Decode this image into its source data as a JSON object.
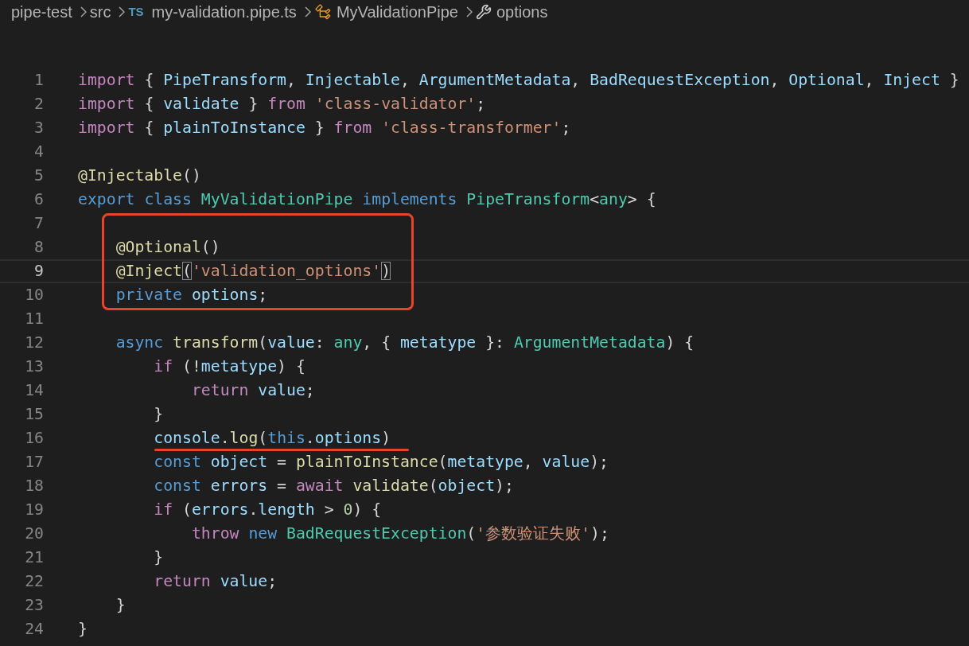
{
  "breadcrumb": [
    {
      "label": "pipe-test"
    },
    {
      "label": "src"
    },
    {
      "label": "my-validation.pipe.ts",
      "badge": "TS"
    },
    {
      "label": "MyValidationPipe",
      "kind": "class"
    },
    {
      "label": "options",
      "kind": "property"
    }
  ],
  "lines": [
    {
      "number": "1",
      "tokens": [
        {
          "kind": "control",
          "text": "import"
        },
        {
          "kind": "plain",
          "text": " { "
        },
        {
          "kind": "variable",
          "text": "PipeTransform"
        },
        {
          "kind": "plain",
          "text": ", "
        },
        {
          "kind": "variable",
          "text": "Injectable"
        },
        {
          "kind": "plain",
          "text": ", "
        },
        {
          "kind": "variable",
          "text": "ArgumentMetadata"
        },
        {
          "kind": "plain",
          "text": ", "
        },
        {
          "kind": "variable",
          "text": "BadRequestException"
        },
        {
          "kind": "plain",
          "text": ", "
        },
        {
          "kind": "variable",
          "text": "Optional"
        },
        {
          "kind": "plain",
          "text": ", "
        },
        {
          "kind": "variable",
          "text": "Inject"
        },
        {
          "kind": "plain",
          "text": " }"
        }
      ]
    },
    {
      "number": "2",
      "tokens": [
        {
          "kind": "control",
          "text": "import"
        },
        {
          "kind": "plain",
          "text": " { "
        },
        {
          "kind": "variable",
          "text": "validate"
        },
        {
          "kind": "plain",
          "text": " } "
        },
        {
          "kind": "control",
          "text": "from"
        },
        {
          "kind": "string",
          "text": " 'class-validator'"
        },
        {
          "kind": "plain",
          "text": ";"
        }
      ]
    },
    {
      "number": "3",
      "tokens": [
        {
          "kind": "control",
          "text": "import"
        },
        {
          "kind": "plain",
          "text": " { "
        },
        {
          "kind": "variable",
          "text": "plainToInstance"
        },
        {
          "kind": "plain",
          "text": " } "
        },
        {
          "kind": "control",
          "text": "from"
        },
        {
          "kind": "string",
          "text": " 'class-transformer'"
        },
        {
          "kind": "plain",
          "text": ";"
        }
      ]
    },
    {
      "number": "4"
    },
    {
      "number": "5",
      "tokens": [
        {
          "kind": "function",
          "text": "@Injectable"
        },
        {
          "kind": "plain",
          "text": "()"
        }
      ]
    },
    {
      "number": "6",
      "tokens": [
        {
          "kind": "keyword",
          "text": "export"
        },
        {
          "kind": "keyword",
          "text": " class"
        },
        {
          "kind": "type",
          "text": " MyValidationPipe"
        },
        {
          "kind": "keyword",
          "text": " implements"
        },
        {
          "kind": "type",
          "text": " PipeTransform"
        },
        {
          "kind": "plain",
          "text": "<"
        },
        {
          "kind": "type",
          "text": "any"
        },
        {
          "kind": "plain",
          "text": "> {"
        }
      ]
    },
    {
      "number": "7",
      "boxed": true
    },
    {
      "number": "8",
      "boxed": true,
      "tokens": [
        {
          "kind": "function",
          "text": "    @Optional"
        },
        {
          "kind": "plain",
          "text": "()"
        }
      ]
    },
    {
      "number": "9",
      "boxed": true,
      "current": true,
      "tokens": [
        {
          "kind": "function",
          "text": "    @Inject"
        },
        {
          "kind": "bracket",
          "text": "("
        },
        {
          "kind": "string",
          "text": "'validation_options'"
        },
        {
          "kind": "bracket",
          "text": ")"
        }
      ]
    },
    {
      "number": "10",
      "boxed": true,
      "tokens": [
        {
          "kind": "keyword",
          "text": "    private"
        },
        {
          "kind": "variable",
          "text": " options"
        },
        {
          "kind": "plain",
          "text": ";"
        }
      ]
    },
    {
      "number": "11"
    },
    {
      "number": "12",
      "tokens": [
        {
          "kind": "keyword",
          "text": "    async"
        },
        {
          "kind": "function",
          "text": " transform"
        },
        {
          "kind": "plain",
          "text": "("
        },
        {
          "kind": "variable",
          "text": "value"
        },
        {
          "kind": "plain",
          "text": ": "
        },
        {
          "kind": "type",
          "text": "any"
        },
        {
          "kind": "plain",
          "text": ", { "
        },
        {
          "kind": "variable",
          "text": "metatype"
        },
        {
          "kind": "plain",
          "text": " }: "
        },
        {
          "kind": "type",
          "text": "ArgumentMetadata"
        },
        {
          "kind": "plain",
          "text": ") {"
        }
      ]
    },
    {
      "number": "13",
      "tokens": [
        {
          "kind": "control",
          "text": "        if"
        },
        {
          "kind": "plain",
          "text": " (!"
        },
        {
          "kind": "variable",
          "text": "metatype"
        },
        {
          "kind": "plain",
          "text": ") {"
        }
      ]
    },
    {
      "number": "14",
      "tokens": [
        {
          "kind": "control",
          "text": "            return"
        },
        {
          "kind": "variable",
          "text": " value"
        },
        {
          "kind": "plain",
          "text": ";"
        }
      ]
    },
    {
      "number": "15",
      "tokens": [
        {
          "kind": "plain",
          "text": "        }"
        }
      ]
    },
    {
      "number": "16",
      "underlined": true,
      "tokens": [
        {
          "kind": "variable",
          "text": "        console"
        },
        {
          "kind": "plain",
          "text": "."
        },
        {
          "kind": "function",
          "text": "log"
        },
        {
          "kind": "plain",
          "text": "("
        },
        {
          "kind": "keyword",
          "text": "this"
        },
        {
          "kind": "plain",
          "text": "."
        },
        {
          "kind": "variable",
          "text": "options"
        },
        {
          "kind": "plain",
          "text": ")"
        }
      ]
    },
    {
      "number": "17",
      "tokens": [
        {
          "kind": "keyword",
          "text": "        const"
        },
        {
          "kind": "variable",
          "text": " object"
        },
        {
          "kind": "plain",
          "text": " = "
        },
        {
          "kind": "function",
          "text": "plainToInstance"
        },
        {
          "kind": "plain",
          "text": "("
        },
        {
          "kind": "variable",
          "text": "metatype"
        },
        {
          "kind": "plain",
          "text": ", "
        },
        {
          "kind": "variable",
          "text": "value"
        },
        {
          "kind": "plain",
          "text": ");"
        }
      ]
    },
    {
      "number": "18",
      "tokens": [
        {
          "kind": "keyword",
          "text": "        const"
        },
        {
          "kind": "variable",
          "text": " errors"
        },
        {
          "kind": "plain",
          "text": " = "
        },
        {
          "kind": "control",
          "text": "await"
        },
        {
          "kind": "function",
          "text": " validate"
        },
        {
          "kind": "plain",
          "text": "("
        },
        {
          "kind": "variable",
          "text": "object"
        },
        {
          "kind": "plain",
          "text": ");"
        }
      ]
    },
    {
      "number": "19",
      "tokens": [
        {
          "kind": "control",
          "text": "        if"
        },
        {
          "kind": "plain",
          "text": " ("
        },
        {
          "kind": "variable",
          "text": "errors"
        },
        {
          "kind": "plain",
          "text": "."
        },
        {
          "kind": "variable",
          "text": "length"
        },
        {
          "kind": "plain",
          "text": " > "
        },
        {
          "kind": "number",
          "text": "0"
        },
        {
          "kind": "plain",
          "text": ") {"
        }
      ]
    },
    {
      "number": "20",
      "tokens": [
        {
          "kind": "control",
          "text": "            throw"
        },
        {
          "kind": "keyword",
          "text": " new"
        },
        {
          "kind": "type",
          "text": " BadRequestException"
        },
        {
          "kind": "plain",
          "text": "("
        },
        {
          "kind": "string",
          "text": "'参数验证失败'"
        },
        {
          "kind": "plain",
          "text": ");"
        }
      ]
    },
    {
      "number": "21",
      "tokens": [
        {
          "kind": "plain",
          "text": "        }"
        }
      ]
    },
    {
      "number": "22",
      "tokens": [
        {
          "kind": "control",
          "text": "        return"
        },
        {
          "kind": "variable",
          "text": " value"
        },
        {
          "kind": "plain",
          "text": ";"
        }
      ]
    },
    {
      "number": "23",
      "tokens": [
        {
          "kind": "plain",
          "text": "    }"
        }
      ]
    },
    {
      "number": "24",
      "tokens": [
        {
          "kind": "plain",
          "text": "}"
        }
      ]
    }
  ]
}
